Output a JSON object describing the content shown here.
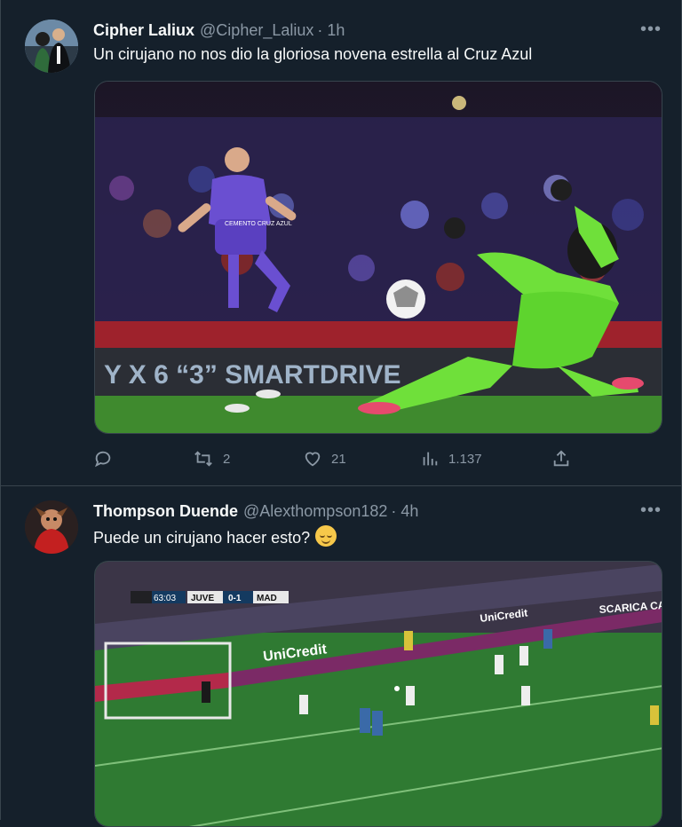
{
  "tweets": [
    {
      "display_name": "Cipher Laliux",
      "handle": "@Cipher_Laliux",
      "time": "· 1h",
      "text": "Un cirujano no nos dio la gloriosa novena estrella al Cruz Azul",
      "media_icon": "photo-soccer-goalkeeper-save",
      "banner_text": "Y X 6 “3”  SMARTDRIVE",
      "jersey_text": "CEMENTO CRUZ AZUL",
      "actions": {
        "reply": "",
        "retweets": "2",
        "likes": "21",
        "views": "1.137"
      }
    },
    {
      "display_name": "Thompson Duende",
      "handle": "@Alexthompson182",
      "time": "· 4h",
      "text": "Puede un cirujano hacer esto?",
      "emoji": "relieved-face-emoji",
      "media_icon": "photo-soccer-match-broadcast",
      "scoreboard": {
        "clock": "63:03",
        "home": "JUVE",
        "score": "0-1",
        "away": "MAD"
      },
      "ads": [
        "UniCredit",
        "SCARICA CAPS",
        "UniCredit"
      ]
    }
  ],
  "colors": {
    "background": "#15202b",
    "text": "#f7f9f9",
    "muted": "#8b98a5",
    "border": "#38444d",
    "pitch": "#3f8a2e",
    "kit_purple": "#6a4fd1",
    "kit_green": "#6fe03a"
  }
}
